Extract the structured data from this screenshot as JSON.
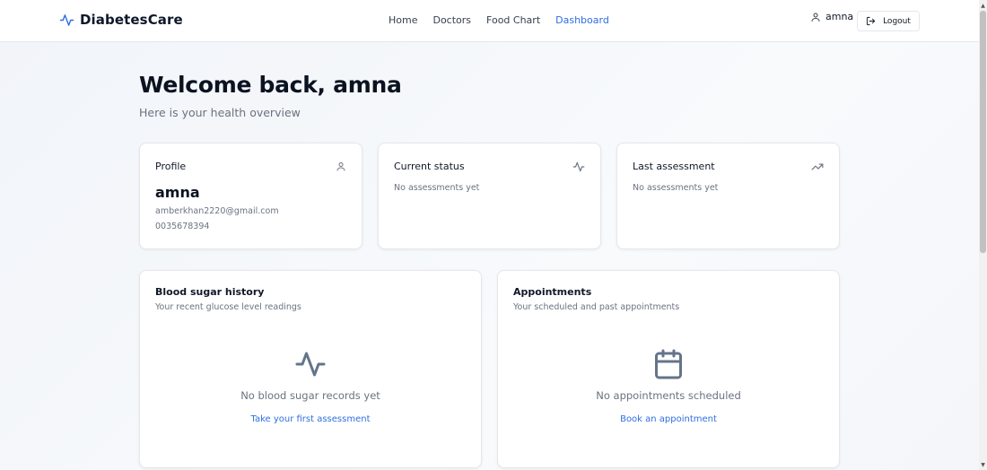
{
  "brand": {
    "name": "DiabetesCare",
    "accent": "#2f6fe0"
  },
  "nav": {
    "links": [
      {
        "label": "Home"
      },
      {
        "label": "Doctors"
      },
      {
        "label": "Food Chart"
      },
      {
        "label": "Dashboard"
      }
    ],
    "active": "Dashboard",
    "user_name": "amna",
    "logout_label": "Logout"
  },
  "welcome": {
    "title": "Welcome back, amna",
    "subtitle": "Here is your health overview"
  },
  "cards": {
    "profile": {
      "title": "Profile",
      "name": "amna",
      "email": "amberkhan2220@gmail.com",
      "phone": "0035678394",
      "icon": "user-icon"
    },
    "current_status": {
      "title": "Current status",
      "text": "No assessments yet",
      "icon": "activity-icon"
    },
    "last_assessment": {
      "title": "Last assessment",
      "text": "No assessments yet",
      "icon": "trending-up-icon"
    }
  },
  "blood_sugar": {
    "title": "Blood sugar history",
    "subtitle": "Your recent glucose level readings",
    "empty_text": "No blood sugar records yet",
    "link": "Take your first assessment",
    "icon": "activity-icon"
  },
  "appointments": {
    "title": "Appointments",
    "subtitle": "Your scheduled and past appointments",
    "empty_text": "No appointments scheduled",
    "link": "Book an appointment",
    "icon": "calendar-icon"
  }
}
